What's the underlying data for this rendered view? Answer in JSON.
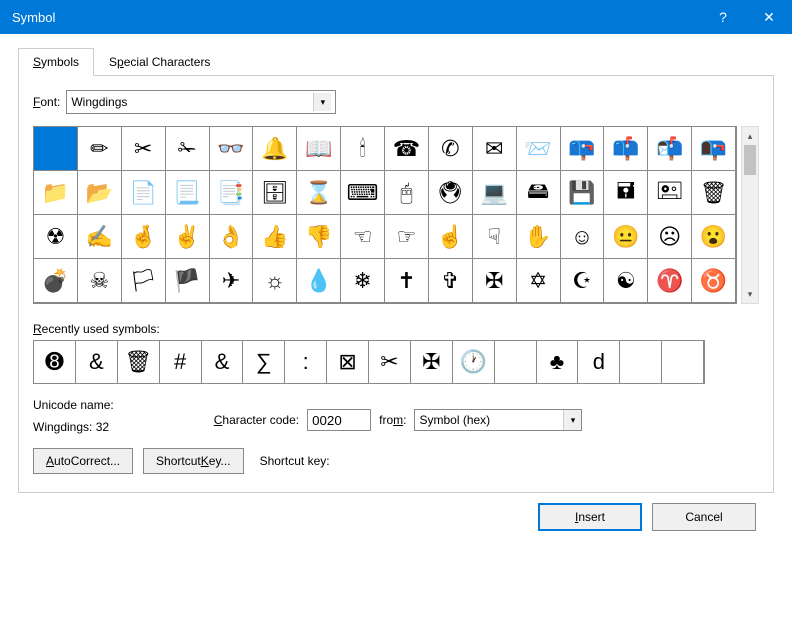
{
  "title": "Symbol",
  "tabs": {
    "symbols": "Symbols",
    "special": "Special Characters"
  },
  "font_label": "Font:",
  "font_value": "Wingdings",
  "symbol_grid": [
    [
      "",
      "✏",
      "✂",
      "✁",
      "👓",
      "🔔",
      "📖",
      "🕯",
      "☎",
      "✆",
      "✉",
      "📨",
      "📪",
      "📫",
      "📬",
      "📭"
    ],
    [
      "📁",
      "📂",
      "📄",
      "📃",
      "📑",
      "🗄",
      "⌛",
      "⌨",
      "🖰",
      "🖲",
      "💻",
      "🖴",
      "💾",
      "🖬",
      "🖭",
      "🗑"
    ],
    [
      "☢",
      "✍",
      "🤞",
      "✌",
      "👌",
      "👍",
      "👎",
      "☜",
      "☞",
      "☝",
      "☟",
      "✋",
      "☺",
      "😐",
      "☹",
      "😮"
    ],
    [
      "💣",
      "☠",
      "🏳",
      "🏴",
      "✈",
      "☼",
      "💧",
      "❄",
      "✝",
      "✞",
      "✠",
      "✡",
      "☪",
      "☯",
      "♈",
      "♉"
    ]
  ],
  "recent_label": "Recently used symbols:",
  "recent_symbols": [
    "➑",
    "&",
    "🗑",
    "#",
    "&",
    "∑",
    ":",
    "⊠",
    "✂",
    "✠",
    "🕐",
    "",
    "♣",
    "d",
    "",
    ""
  ],
  "unicode_name_label": "Unicode name:",
  "unicode_name_value": "Wingdings: 32",
  "char_code_label": "Character code:",
  "char_code_value": "0020",
  "from_label": "from:",
  "from_value": "Symbol (hex)",
  "buttons": {
    "autocorrect": "AutoCorrect...",
    "shortcut_key": "Shortcut Key...",
    "insert": "Insert",
    "cancel": "Cancel"
  },
  "shortcut_label": "Shortcut key:"
}
